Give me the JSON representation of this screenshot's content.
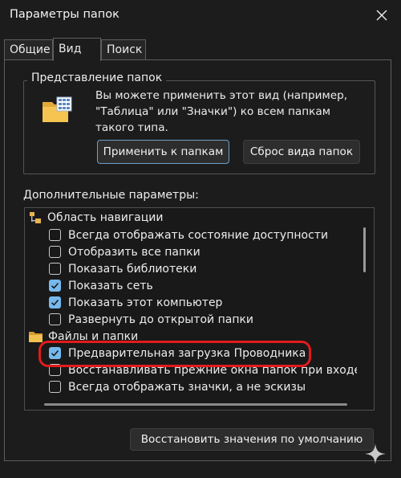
{
  "window": {
    "title": "Параметры папок",
    "close_icon": "close-icon"
  },
  "tabs": [
    {
      "label": "Общие",
      "active": false
    },
    {
      "label": "Вид",
      "active": true
    },
    {
      "label": "Поиск",
      "active": false
    }
  ],
  "folder_views": {
    "group_title": "Представление папок",
    "icon": "folder-grid-icon",
    "description": "Вы можете применить этот вид (например, \"Таблица\" или \"Значки\") ко всем папкам такого типа.",
    "apply_button": "Применить к папкам",
    "reset_button": "Сброс вида папок"
  },
  "advanced": {
    "label": "Дополнительные параметры:",
    "items": [
      {
        "type": "category",
        "icon": "navigation-pane-icon",
        "label": "Область навигации"
      },
      {
        "type": "checkbox",
        "checked": false,
        "label": "Всегда отображать состояние доступности"
      },
      {
        "type": "checkbox",
        "checked": false,
        "label": "Отобразить все папки"
      },
      {
        "type": "checkbox",
        "checked": false,
        "label": "Показать библиотеки"
      },
      {
        "type": "checkbox",
        "checked": true,
        "label": "Показать сеть"
      },
      {
        "type": "checkbox",
        "checked": true,
        "label": "Показать этот компьютер"
      },
      {
        "type": "checkbox",
        "checked": false,
        "label": "Развернуть до открытой папки"
      },
      {
        "type": "category",
        "icon": "folder-icon",
        "label": "Файлы и папки"
      },
      {
        "type": "checkbox",
        "checked": true,
        "label": "Предварительная загрузка Проводника",
        "highlighted": true
      },
      {
        "type": "checkbox",
        "checked": false,
        "label": "Восстанавливать прежние окна папок при входе в си"
      },
      {
        "type": "checkbox",
        "checked": false,
        "label": "Всегда отображать значки, а не эскизы"
      }
    ]
  },
  "restore_button": "Восстановить значения по умолчанию",
  "colors": {
    "background": "#1c1c1c",
    "accent_check": "#76b9ed",
    "highlight": "#e21b1b"
  }
}
